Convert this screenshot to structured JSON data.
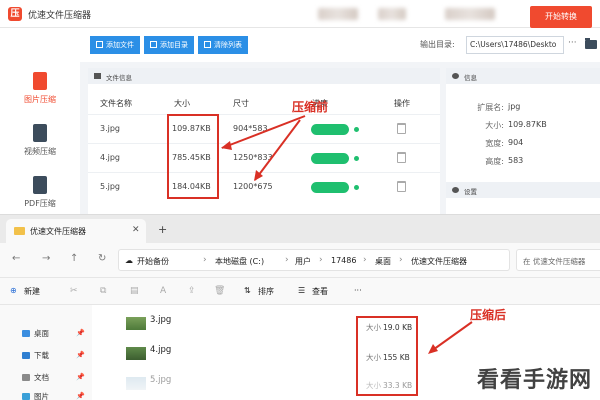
{
  "app": {
    "title": "优速文件压缩器",
    "toolbar": {
      "add_file": "添加文件",
      "add_folder": "添加目录",
      "clear_list": "清除列表",
      "output_label": "输出目录:",
      "output_path": "C:\\Users\\17486\\Deskto",
      "more": "···",
      "start": "开始转换"
    },
    "sidebar": [
      {
        "label": "图片压缩",
        "icon": "image-file-icon",
        "color": "#f04a2f",
        "active": true
      },
      {
        "label": "视频压缩",
        "icon": "video-file-icon",
        "color": "#3c4c5c",
        "active": false
      },
      {
        "label": "PDF压缩",
        "icon": "pdf-file-icon",
        "color": "#3c4c5c",
        "active": false
      }
    ],
    "file_panel": {
      "title": "文件信息",
      "columns": [
        "文件名称",
        "大小",
        "尺寸",
        "进度",
        "操作"
      ],
      "rows": [
        {
          "name": "3.jpg",
          "size": "109.87KB",
          "dims": "904*583"
        },
        {
          "name": "4.jpg",
          "size": "785.45KB",
          "dims": "1250*833"
        },
        {
          "name": "5.jpg",
          "size": "184.04KB",
          "dims": "1200*675"
        }
      ]
    },
    "info_panel": {
      "title": "信息",
      "fields": [
        {
          "label": "扩展名:",
          "value": "jpg"
        },
        {
          "label": "大小:",
          "value": "109.87KB"
        },
        {
          "label": "宽度:",
          "value": "904"
        },
        {
          "label": "高度:",
          "value": "583"
        }
      ],
      "settings_title": "设置"
    }
  },
  "annotations": {
    "before": "压缩前",
    "after": "压缩后"
  },
  "explorer": {
    "tab_title": "优速文件压缩器",
    "new_tab": "+",
    "path": [
      "开始备份",
      "本地磁盘 (C:)",
      "用户",
      "17486",
      "桌面",
      "优速文件压缩器"
    ],
    "search_placeholder": "在 优速文件压缩器",
    "commands": {
      "new": "新建",
      "sort": "排序",
      "view": "查看",
      "more": "···"
    },
    "nav": [
      {
        "label": "桌面",
        "color": "#3b8ee0"
      },
      {
        "label": "下载",
        "color": "#2f7fd1"
      },
      {
        "label": "文档",
        "color": "#8a8a8a"
      },
      {
        "label": "图片",
        "color": "#3aa0d8"
      }
    ],
    "files": [
      {
        "name": "3.jpg",
        "size_label": "大小",
        "size": "19.0 KB"
      },
      {
        "name": "4.jpg",
        "size_label": "大小",
        "size": "155 KB"
      },
      {
        "name": "5.jpg",
        "size_label": "大小",
        "size": "33.3 KB"
      }
    ]
  },
  "watermark": "看看手游网",
  "colors": {
    "accent_red": "#f04a2f",
    "accent_blue": "#2b8fe6",
    "progress_green": "#1fbf6f",
    "annotation": "#d93025"
  }
}
